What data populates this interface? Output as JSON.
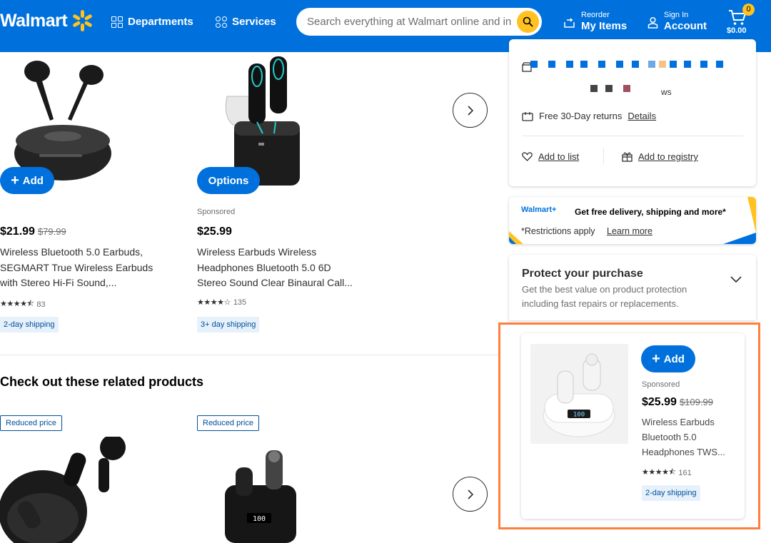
{
  "header": {
    "logo": "Walmart",
    "departments": "Departments",
    "services": "Services",
    "search_placeholder": "Search everything at Walmart online and in store",
    "reorder_small": "Reorder",
    "reorder_big": "My Items",
    "signin_small": "Sign In",
    "signin_big": "Account",
    "cart_count": "0",
    "cart_total": "$0.00"
  },
  "carousel1": [
    {
      "button": "Add",
      "sponsored": "",
      "price": "$21.99",
      "was": "$79.99",
      "title_line1": "Wireless Bluetooth 5.0 Earbuds,",
      "title_line2": "SEGMART True Wireless Earbuds",
      "title_line3": "with Stereo Hi-Fi Sound,...",
      "rating_count": "83",
      "shipping": "2-day shipping"
    },
    {
      "button": "Options",
      "sponsored": "Sponsored",
      "price": "$25.99",
      "was": "",
      "title_line1": "Wireless Earbuds Wireless",
      "title_line2": "Headphones Bluetooth 5.0 6D",
      "title_line3": "Stereo Sound Clear Binaural Call...",
      "rating_count": "135",
      "shipping": "3+ day shipping"
    }
  ],
  "related": {
    "title": "Check out these related products",
    "badge1": "Reduced price",
    "badge2": "Reduced price"
  },
  "panel": {
    "free_returns": "Free 30-Day returns",
    "details": "Details",
    "add_to_list": "Add to list",
    "add_to_registry": "Add to registry",
    "reviews_fragment": "ws"
  },
  "promo": {
    "brand": "Walmart+",
    "headline": "Get free delivery, shipping and more*",
    "restrictions": "*Restrictions apply",
    "learn_more": "Learn more"
  },
  "protect": {
    "title": "Protect your purchase",
    "sub_line1": "Get the best value on product protection",
    "sub_line2": "including fast repairs or replacements."
  },
  "ad": {
    "button": "Add",
    "sponsored": "Sponsored",
    "price": "$25.99",
    "was": "$109.99",
    "title_line1": "Wireless Earbuds",
    "title_line2": "Bluetooth 5.0",
    "title_line3": "Headphones TWS...",
    "rating_count": "161",
    "shipping": "2-day shipping"
  },
  "colors": {
    "brand_blue": "#0071dc",
    "spark_yellow": "#ffc220",
    "highlight_orange": "#ff7f3f"
  }
}
